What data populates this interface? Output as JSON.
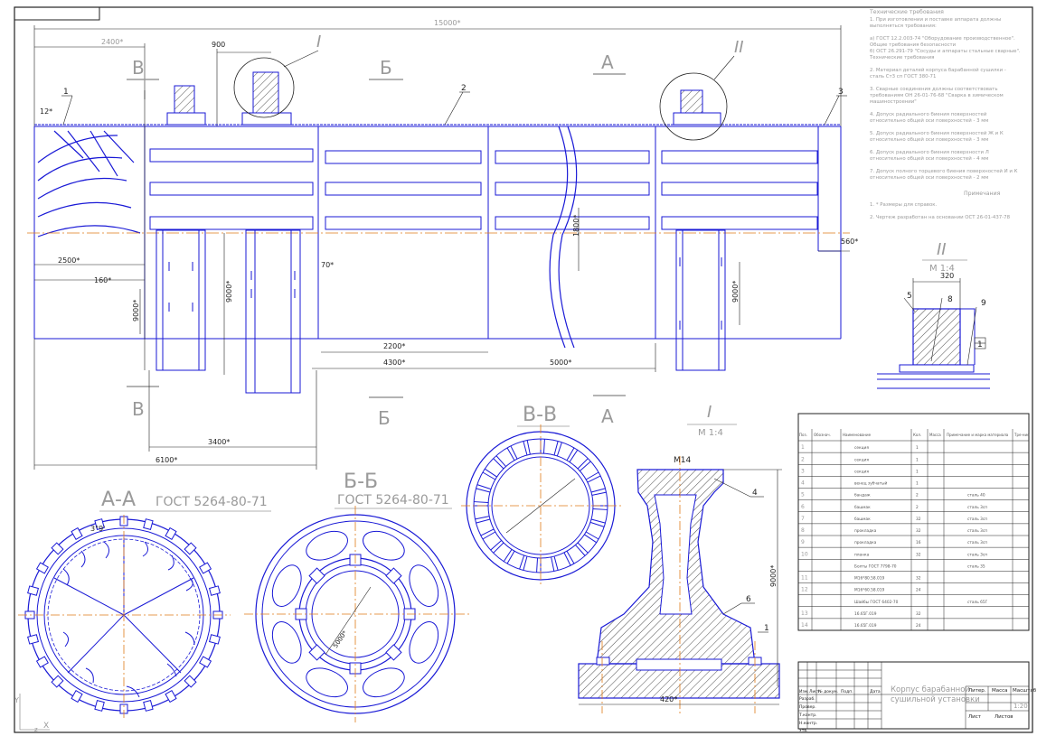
{
  "drawing": {
    "overall_length": "15000*",
    "dims": {
      "d2400": "2400*",
      "d900": "900",
      "d12": "12*",
      "d2500": "2500*",
      "d160": "160*",
      "d3400": "3400*",
      "d6100": "6100*",
      "d2200": "2200*",
      "d4300": "4300*",
      "d5000": "5000*",
      "d560": "560*",
      "d1800": "1800*",
      "d9000a": "9000*",
      "d9000b": "9000*",
      "d9000c": "9000*",
      "d70": "70*",
      "d3_9": "3°9'",
      "d5000b": "5000*",
      "d420": "420*",
      "d9000d": "9000*",
      "d320": "320",
      "m14": "M14"
    },
    "section_letters": {
      "v_top": "В",
      "b_top": "Б",
      "a_top": "А",
      "v_bot": "В",
      "b_bot": "Б",
      "a_bot": "А"
    },
    "roman": {
      "one": "I",
      "two": "II"
    },
    "callouts": [
      "1",
      "2",
      "3",
      "4",
      "5",
      "6",
      "8",
      "9",
      "1",
      "1"
    ],
    "views": {
      "aa": {
        "title": "А-А",
        "gost": "ГОСТ 5264-80-71"
      },
      "bb": {
        "title": "Б-Б",
        "gost": "ГОСТ 5264-80-71"
      },
      "vv": {
        "title": "В-В"
      },
      "detail_i": {
        "title": "I",
        "scale": "М 1:4"
      },
      "detail_ii": {
        "title": "II",
        "scale": "М 1:4"
      }
    },
    "axis": {
      "y": "Y",
      "x": "X",
      "z": "z"
    }
  },
  "notes": {
    "heading": "Технические требования",
    "lines": [
      "1. При изготовлении и поставке аппарата должны",
      "выполняться требования:",
      "",
      "а) ГОСТ 12.2.003-74 \"Оборудование производственное\".",
      "Общие требования безопасности",
      "б) ОСТ 26.291-79 \"Сосуды и аппараты стальные сварные\".",
      "Технические требования",
      "",
      "2. Материал деталей корпуса барабанной сушилки -",
      "сталь Ст3 сп ГОСТ 380-71",
      "",
      "3. Сварные соединения должны соответствовать",
      "требованиям ОН 26-01-76-68 \"Сварка в химическом",
      "машиностроении\"",
      "",
      "4. Допуск радиального биения поверхностей",
      "относительно общей оси поверхностей - 3 мм",
      "",
      "5. Допуск радиального биения поверхностей Ж и К",
      "относительно общей оси поверхностей - 3 мм",
      "",
      "6. Допуск радиального биения поверхности Л",
      "относительно общей оси поверхностей - 4 мм",
      "",
      "7. Допуск полного торцевого биения поверхностей И и К",
      "относительно общей оси поверхностей - 2 мм"
    ],
    "remarks_heading": "Примечания",
    "remarks": [
      "1. * Размеры для справок.",
      "",
      "2. Чертеж разработан на основании ОСТ 26-01-437-78"
    ]
  },
  "parts_list": {
    "headers": [
      "Поз.",
      "Обознач.",
      "Наименование",
      "Кол.",
      "Масса",
      "Примечание и марка материала",
      "Тре-ние"
    ],
    "rows": [
      {
        "pos": "1",
        "name": "секция",
        "qty": "1",
        "note": ""
      },
      {
        "pos": "2",
        "name": "секция",
        "qty": "1",
        "note": ""
      },
      {
        "pos": "3",
        "name": "секция",
        "qty": "1",
        "note": ""
      },
      {
        "pos": "4",
        "name": "венец зубчатый",
        "qty": "1",
        "note": ""
      },
      {
        "pos": "5",
        "name": "бандаж",
        "qty": "2",
        "note": "сталь 40"
      },
      {
        "pos": "6",
        "name": "башмак",
        "qty": "2",
        "note": "сталь 3сп"
      },
      {
        "pos": "7",
        "name": "башмак",
        "qty": "32",
        "note": "сталь 3сп"
      },
      {
        "pos": "8",
        "name": "прокладка",
        "qty": "32",
        "note": "сталь 3сп"
      },
      {
        "pos": "9",
        "name": "прокладка",
        "qty": "16",
        "note": "сталь 3сп"
      },
      {
        "pos": "10",
        "name": "планка",
        "qty": "32",
        "note": "сталь 3сп"
      },
      {
        "pos": "",
        "name": "Болты ГОСТ 7798-70",
        "qty": "",
        "note": "сталь 35"
      },
      {
        "pos": "11",
        "name": "М16*80.58.019",
        "qty": "32",
        "note": ""
      },
      {
        "pos": "12",
        "name": "М16*60.58.019",
        "qty": "24",
        "note": ""
      },
      {
        "pos": "",
        "name": "Шайбы ГОСТ 6402-70",
        "qty": "",
        "note": "сталь 65Г"
      },
      {
        "pos": "13",
        "name": "16.65Г.019",
        "qty": "32",
        "note": ""
      },
      {
        "pos": "14",
        "name": "16.65Г.019",
        "qty": "24",
        "note": ""
      }
    ]
  },
  "title_block": {
    "name_line1": "Корпус барабанной",
    "name_line2": "сушильной установки",
    "lit": "Литер.",
    "mass": "Масса",
    "scale_label": "Масштаб",
    "scale_value": "1:20",
    "sheet": "Лист",
    "sheets": "Листов",
    "izm": "Изм.",
    "list": "Лист",
    "ndoc": "№ докум.",
    "podp": "Подп.",
    "data": "Дата",
    "razrab": "Разраб.",
    "prov": "Провер.",
    "tkontr": "Т.контр.",
    "nkontr": "Н.контр.",
    "utv": "Утв."
  },
  "colors": {
    "line": "#1a1ad6",
    "center": "#e07b1a",
    "ink": "#222222",
    "grey": "#9a9a9a",
    "light": "#bbbbbb"
  }
}
